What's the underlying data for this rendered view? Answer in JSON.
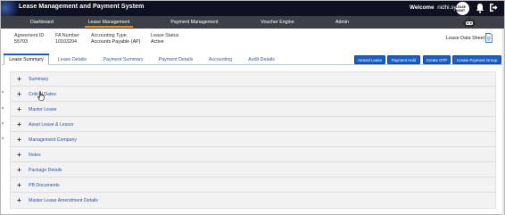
{
  "header": {
    "title": "Lease Management and Payment System",
    "welcome": "Welcome",
    "username": "nidhi.sy",
    "avatar_text": "LEASE MGMT",
    "icons": [
      "bell-icon",
      "logout-icon"
    ]
  },
  "nav": {
    "items": [
      {
        "label": "Dashboard"
      },
      {
        "label": "Lease Management"
      },
      {
        "label": "Payment Management"
      },
      {
        "label": "Voucher Engine"
      },
      {
        "label": "Admin"
      }
    ],
    "active": "Lease Management"
  },
  "info": {
    "agreement_label": "Agreement ID",
    "agreement_value": "55703",
    "fa_label": "FA Number",
    "fa_value": "10103204",
    "accounting_label": "Accounting Type",
    "accounting_value": "Accounts Payable (AP)",
    "status_label": "Lease Status",
    "status_value": "Active",
    "lease_sheet": "Lease Data Sheet"
  },
  "tabs": [
    {
      "label": "Lease Summary"
    },
    {
      "label": "Lease Details"
    },
    {
      "label": "Payment Summary"
    },
    {
      "label": "Payment Details"
    },
    {
      "label": "Accounting"
    },
    {
      "label": "Audit Details"
    }
  ],
  "active_tab": "Lease Summary",
  "actions": [
    {
      "label": "Amend Lease"
    },
    {
      "label": "Payment Hold"
    },
    {
      "label": "Create OTP"
    },
    {
      "label": "Create Payment Group"
    }
  ],
  "sections": [
    {
      "label": "Summary"
    },
    {
      "label": "Critical Dates"
    },
    {
      "label": "Master Lease"
    },
    {
      "label": "Asset Lease & Lessor"
    },
    {
      "label": "Management Company"
    },
    {
      "label": "Notes"
    },
    {
      "label": "Package Details"
    },
    {
      "label": "PB Documents"
    },
    {
      "label": "Master Lease Amendment Details"
    }
  ],
  "colors": {
    "header_bg": "#0f1020",
    "nav_bg": "#3e4047",
    "nav_active_underline": "#d98b2b",
    "button_bg": "#1a5fc8",
    "link_text": "#2d54a6"
  }
}
